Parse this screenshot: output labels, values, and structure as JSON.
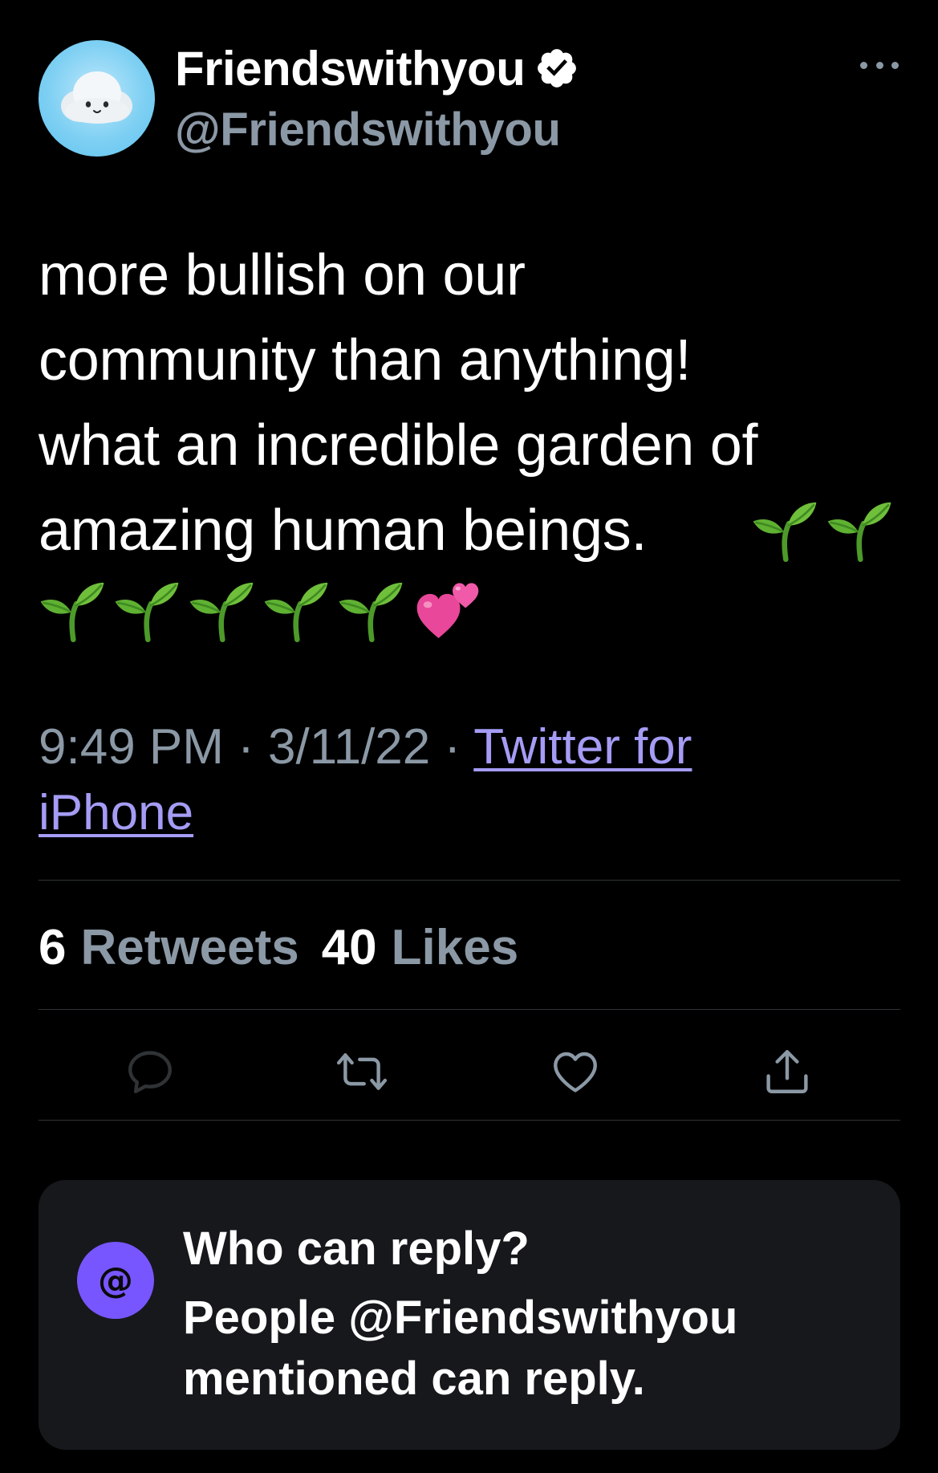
{
  "author": {
    "display_name": "Friendswithyou",
    "handle": "@Friendswithyou",
    "verified": true
  },
  "tweet": {
    "lines": [
      "more bullish on our",
      "community than anything!",
      "what an incredible garden of",
      "amazing human beings."
    ],
    "emojis": [
      "seedling",
      "seedling",
      "seedling",
      "seedling",
      "seedling",
      "seedling",
      "seedling",
      "two-hearts"
    ]
  },
  "meta": {
    "time": "9:49 PM",
    "separator": " · ",
    "date": "3/11/22",
    "source_line1": "Twitter for",
    "source_line2": "iPhone"
  },
  "stats": {
    "retweets_count": "6",
    "retweets_label": "Retweets",
    "likes_count": "40",
    "likes_label": "Likes"
  },
  "actions": [
    "reply-icon",
    "retweet-icon",
    "like-icon",
    "share-icon"
  ],
  "reply_settings": {
    "icon_glyph": "@",
    "title": "Who can reply?",
    "description": "People @Friendswithyou mentioned can reply."
  },
  "colors": {
    "background": "#000000",
    "secondary_text": "#8b98a5",
    "link": "#a59cf5",
    "accent": "#7856ff",
    "divider": "#2f3336",
    "card": "#16181c"
  }
}
